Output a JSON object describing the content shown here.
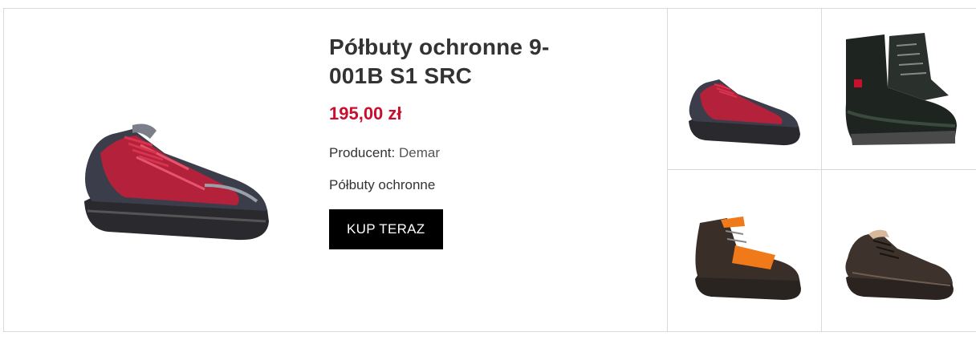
{
  "product": {
    "title": "Półbuty ochronne 9-001B S1 SRC",
    "price": "195,00 zł",
    "producer_label": "Producent:",
    "producer_value": "Demar",
    "category": "Półbuty ochronne",
    "buy_label": "KUP TERAZ"
  },
  "thumbnails": [
    {
      "name": "red-grey-safety-shoe",
      "icon": "shoe-icon"
    },
    {
      "name": "black-snow-boot",
      "icon": "boot-icon"
    },
    {
      "name": "orange-black-safety-boot",
      "icon": "boot-icon"
    },
    {
      "name": "brown-leather-shoe",
      "icon": "shoe-icon"
    }
  ],
  "colors": {
    "price": "#c8102e",
    "button_bg": "#000000",
    "button_text": "#ffffff",
    "border": "#d9d9d9"
  }
}
